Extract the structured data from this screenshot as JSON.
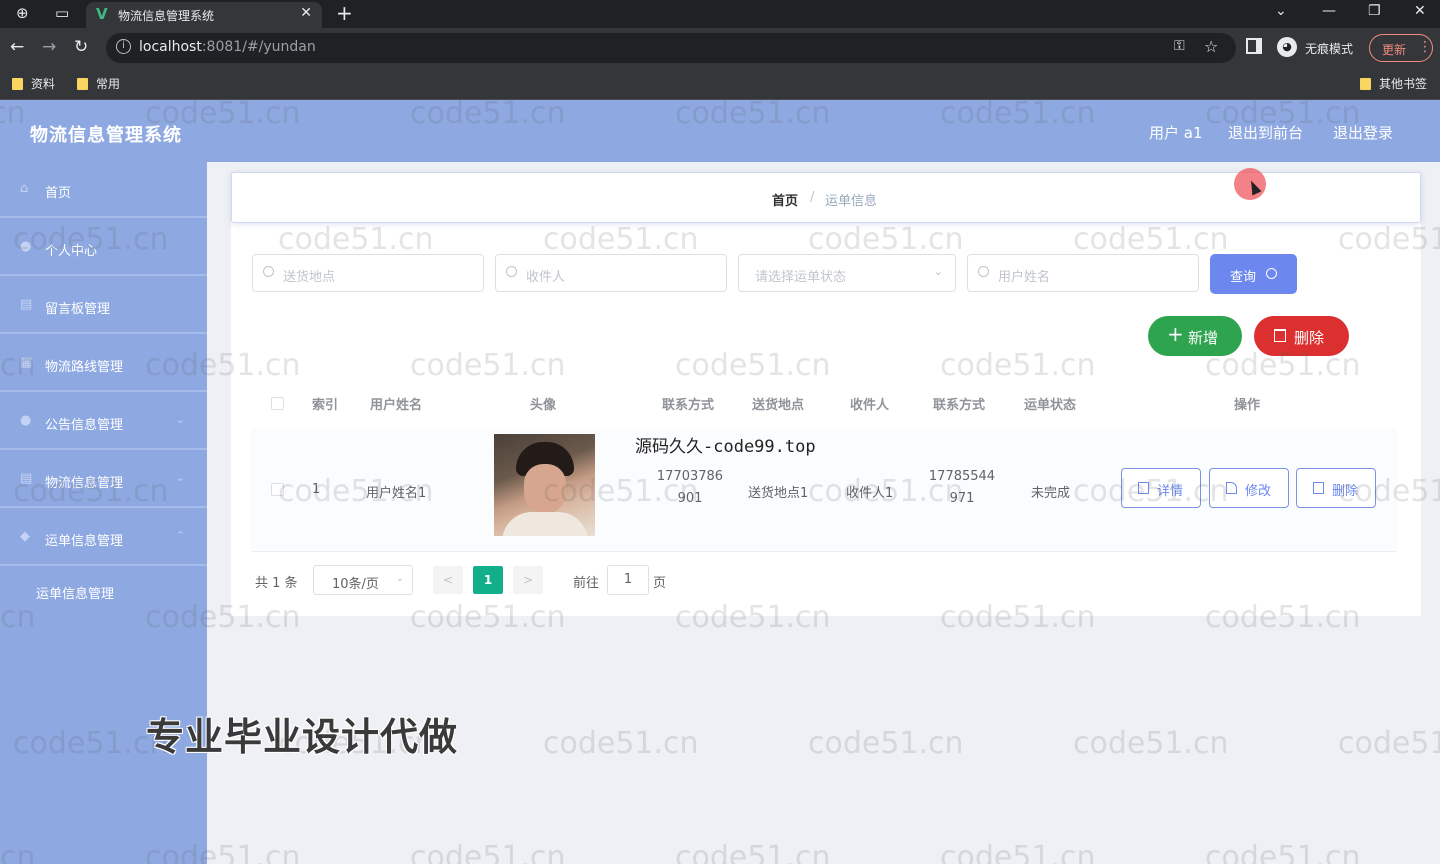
{
  "browser": {
    "tab_title": "物流信息管理系统",
    "tab_favicon": "V",
    "url_host": "localhost",
    "url_rest": ":8081/#/yundan",
    "incognito_label": "无痕模式",
    "update_label": "更新",
    "bookmarks": [
      "资料",
      "常用"
    ],
    "other_bookmarks": "其他书签"
  },
  "header": {
    "title": "物流信息管理系统",
    "user": "用户 a1",
    "back_to_front": "退出到前台",
    "logout": "退出登录"
  },
  "sidebar": {
    "items": [
      {
        "label": "首页",
        "icon": "home-icon",
        "has_arrow": false
      },
      {
        "label": "个人中心",
        "icon": "user-icon",
        "has_arrow": false
      },
      {
        "label": "留言板管理",
        "icon": "message-icon",
        "has_arrow": false
      },
      {
        "label": "物流路线管理",
        "icon": "route-icon",
        "has_arrow": false
      },
      {
        "label": "公告信息管理",
        "icon": "notice-icon",
        "has_arrow": true
      },
      {
        "label": "物流信息管理",
        "icon": "logistics-icon",
        "has_arrow": true
      },
      {
        "label": "运单信息管理",
        "icon": "waybill-icon",
        "has_arrow": true
      }
    ],
    "submenu": "运单信息管理"
  },
  "breadcrumb": {
    "home": "首页",
    "separator": "/",
    "current": "运单信息"
  },
  "search": {
    "send_location_placeholder": "送货地点",
    "receiver_placeholder": "收件人",
    "status_placeholder": "请选择运单状态",
    "username_placeholder": "用户姓名",
    "query_label": "查询"
  },
  "actions": {
    "add_label": "新增",
    "delete_label": "删除"
  },
  "table": {
    "columns": [
      "索引",
      "用户姓名",
      "头像",
      "联系方式",
      "送货地点",
      "收件人",
      "联系方式",
      "运单状态",
      "操作"
    ],
    "rows": [
      {
        "index": "1",
        "username": "用户姓名1",
        "phone_line1": "17703786",
        "phone_line2": "901",
        "send_location": "送货地点1",
        "receiver": "收件人1",
        "receiver_phone_line1": "17785544",
        "receiver_phone_line2": "971",
        "status": "未完成",
        "detail_label": "详情",
        "edit_label": "修改",
        "delete_label": "删除"
      }
    ]
  },
  "overlay_text": "源码久久-code99.top",
  "pagination": {
    "total": "共 1 条",
    "page_size": "10条/页",
    "prev": "<",
    "current_page": "1",
    "next": ">",
    "goto_label": "前往",
    "goto_value": "1",
    "page_suffix": "页"
  },
  "watermark_text": "code51.cn",
  "promo_text": "专业毕业设计代做",
  "colors": {
    "sidebar_bg": "#8ea9e2",
    "primary": "#6c88ee",
    "success": "#2ea44f",
    "danger": "#dc3030",
    "pager_active": "#12b08a"
  }
}
